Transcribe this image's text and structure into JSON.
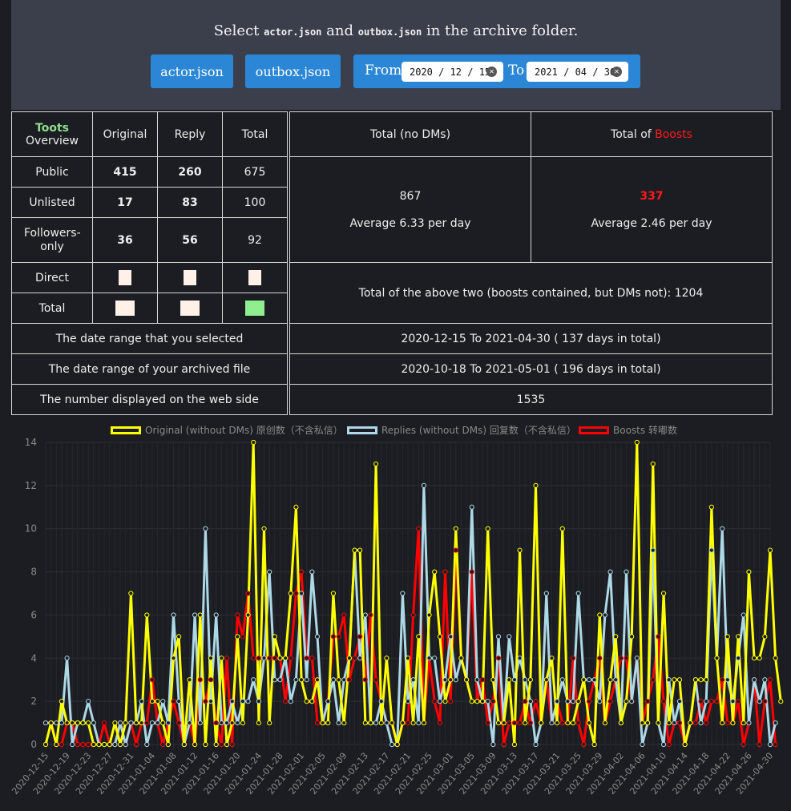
{
  "header": {
    "select_prefix": "Select",
    "file1": "actor.json",
    "and": "and",
    "file2": "outbox.json",
    "select_suffix": "in the archive folder.",
    "btn_actor": "actor.json",
    "btn_outbox": "outbox.json",
    "from_label": "From",
    "from_value": "2020 / 12 / 15",
    "to_label": "To",
    "to_value": "2021 / 04 / 30"
  },
  "table": {
    "toots": "Toots",
    "overview": "Overview",
    "col_original": "Original",
    "col_reply": "Reply",
    "col_total": "Total",
    "col_total_nodm": "Total (no DMs)",
    "col_total_of": "Total of",
    "col_boosts": "Boosts",
    "rows": [
      {
        "label": "Public",
        "original": "415",
        "reply": "260",
        "total": "675"
      },
      {
        "label": "Unlisted",
        "original": "17",
        "reply": "83",
        "total": "100"
      },
      {
        "label": "Followers-only",
        "original": "36",
        "reply": "56",
        "total": "92"
      },
      {
        "label": "Direct"
      },
      {
        "label": "Total"
      }
    ],
    "total_nodm_value": "867",
    "total_nodm_avg": "Average 6.33 per day",
    "boosts_value": "337",
    "boosts_avg": "Average 2.46 per day",
    "combined": "Total of the above two (boosts contained, but DMs not): 1204",
    "range_selected_label": "The date range that you selected",
    "range_selected_value": "2020-12-15 To 2021-04-30 ( 137 days in total)",
    "range_archive_label": "The date range of your archived file",
    "range_archive_value": "2020-10-18 To 2021-05-01 ( 196 days in total)",
    "web_label": "The number displayed on the web side",
    "web_value": "1535"
  },
  "colors": {
    "original": "#ffff00",
    "replies": "#add8e6",
    "boosts": "#ff0000",
    "square_light": "#fff0e8",
    "square_green": "#90ee90"
  },
  "chart_data": {
    "type": "line",
    "ylim": [
      0,
      14
    ],
    "yticks": [
      0,
      2,
      4,
      6,
      8,
      10,
      12,
      14
    ],
    "grid": true,
    "legend": "top",
    "x": [
      "2020-12-15",
      "2020-12-16",
      "2020-12-17",
      "2020-12-18",
      "2020-12-19",
      "2020-12-20",
      "2020-12-21",
      "2020-12-22",
      "2020-12-23",
      "2020-12-24",
      "2020-12-25",
      "2020-12-26",
      "2020-12-27",
      "2020-12-28",
      "2020-12-29",
      "2020-12-30",
      "2020-12-31",
      "2021-01-01",
      "2021-01-02",
      "2021-01-03",
      "2021-01-04",
      "2021-01-05",
      "2021-01-06",
      "2021-01-07",
      "2021-01-08",
      "2021-01-09",
      "2021-01-10",
      "2021-01-11",
      "2021-01-12",
      "2021-01-13",
      "2021-01-14",
      "2021-01-15",
      "2021-01-16",
      "2021-01-17",
      "2021-01-18",
      "2021-01-19",
      "2021-01-20",
      "2021-01-21",
      "2021-01-22",
      "2021-01-23",
      "2021-01-24",
      "2021-01-25",
      "2021-01-26",
      "2021-01-27",
      "2021-01-28",
      "2021-01-29",
      "2021-01-30",
      "2021-01-31",
      "2021-02-01",
      "2021-02-02",
      "2021-02-03",
      "2021-02-04",
      "2021-02-05",
      "2021-02-06",
      "2021-02-07",
      "2021-02-08",
      "2021-02-09",
      "2021-02-10",
      "2021-02-11",
      "2021-02-12",
      "2021-02-13",
      "2021-02-14",
      "2021-02-15",
      "2021-02-16",
      "2021-02-17",
      "2021-02-18",
      "2021-02-19",
      "2021-02-20",
      "2021-02-21",
      "2021-02-22",
      "2021-02-23",
      "2021-02-24",
      "2021-02-25",
      "2021-02-26",
      "2021-02-27",
      "2021-02-28",
      "2021-03-01",
      "2021-03-02",
      "2021-03-03",
      "2021-03-04",
      "2021-03-05",
      "2021-03-06",
      "2021-03-07",
      "2021-03-08",
      "2021-03-09",
      "2021-03-10",
      "2021-03-11",
      "2021-03-12",
      "2021-03-13",
      "2021-03-14",
      "2021-03-15",
      "2021-03-16",
      "2021-03-17",
      "2021-03-18",
      "2021-03-19",
      "2021-03-20",
      "2021-03-21",
      "2021-03-22",
      "2021-03-23",
      "2021-03-24",
      "2021-03-25",
      "2021-03-26",
      "2021-03-27",
      "2021-03-28",
      "2021-03-29",
      "2021-03-30",
      "2021-03-31",
      "2021-04-01",
      "2021-04-02",
      "2021-04-03",
      "2021-04-04",
      "2021-04-05",
      "2021-04-06",
      "2021-04-07",
      "2021-04-08",
      "2021-04-09",
      "2021-04-10",
      "2021-04-11",
      "2021-04-12",
      "2021-04-13",
      "2021-04-14",
      "2021-04-15",
      "2021-04-16",
      "2021-04-17",
      "2021-04-18",
      "2021-04-19",
      "2021-04-20",
      "2021-04-21",
      "2021-04-22",
      "2021-04-23",
      "2021-04-24",
      "2021-04-25",
      "2021-04-26",
      "2021-04-27",
      "2021-04-28",
      "2021-04-29",
      "2021-04-30"
    ],
    "xtick_labels": [
      "2020-12-15",
      "2020-12-19",
      "2020-12-23",
      "2020-12-27",
      "2020-12-31",
      "2021-01-04",
      "2021-01-08",
      "2021-01-12",
      "2021-01-16",
      "2021-01-20",
      "2021-01-24",
      "2021-01-28",
      "2021-02-01",
      "2021-02-05",
      "2021-02-09",
      "2021-02-13",
      "2021-02-17",
      "2021-02-21",
      "2021-02-25",
      "2021-03-01",
      "2021-03-05",
      "2021-03-09",
      "2021-03-13",
      "2021-03-17",
      "2021-03-21",
      "2021-03-25",
      "2021-03-29",
      "2021-04-02",
      "2021-04-06",
      "2021-04-10",
      "2021-04-14",
      "2021-04-18",
      "2021-04-22",
      "2021-04-26",
      "2021-04-30"
    ],
    "series": [
      {
        "name": "Original (without DMs) 原创数（不含私信）",
        "color": "#ffff00",
        "values": [
          0,
          1,
          0,
          2,
          1,
          1,
          1,
          1,
          1,
          0,
          0,
          0,
          0,
          1,
          0,
          1,
          7,
          1,
          1,
          6,
          2,
          2,
          1,
          0,
          4,
          5,
          0,
          3,
          0,
          6,
          0,
          4,
          0,
          4,
          0,
          1,
          5,
          1,
          6,
          14,
          1,
          10,
          1,
          5,
          4,
          4,
          7,
          11,
          3,
          2,
          2,
          3,
          1,
          1,
          7,
          3,
          1,
          4,
          9,
          9,
          1,
          1,
          13,
          1,
          4,
          1,
          0,
          1,
          4,
          1,
          5,
          1,
          6,
          8,
          5,
          2,
          3,
          10,
          4,
          3,
          2,
          2,
          2,
          10,
          3,
          1,
          1,
          3,
          0,
          9,
          1,
          3,
          12,
          1,
          3,
          4,
          1,
          10,
          1,
          1,
          2,
          3,
          1,
          0,
          6,
          1,
          3,
          5,
          1,
          2,
          5,
          14,
          1,
          1,
          13,
          1,
          7,
          1,
          3,
          3,
          0,
          1,
          3,
          3,
          3,
          11,
          4,
          1,
          5,
          1,
          5,
          1,
          8,
          4,
          4,
          5,
          9,
          4,
          2
        ]
      },
      {
        "name": "Replies (without DMs) 回复数（不含私信）",
        "color": "#add8e6",
        "values": [
          1,
          1,
          1,
          1,
          4,
          0,
          1,
          1,
          2,
          1,
          0,
          0,
          0,
          0,
          1,
          0,
          1,
          1,
          2,
          0,
          1,
          1,
          2,
          1,
          6,
          2,
          0,
          1,
          6,
          1,
          10,
          2,
          6,
          1,
          1,
          2,
          1,
          2,
          2,
          3,
          2,
          4,
          8,
          3,
          3,
          4,
          2,
          3,
          7,
          3,
          8,
          5,
          1,
          2,
          3,
          1,
          3,
          4,
          9,
          4,
          6,
          1,
          1,
          2,
          1,
          0,
          0,
          7,
          2,
          3,
          1,
          12,
          4,
          4,
          2,
          3,
          5,
          3,
          4,
          3,
          11,
          3,
          2,
          2,
          0,
          5,
          1,
          5,
          3,
          4,
          3,
          2,
          0,
          1,
          7,
          1,
          2,
          3,
          2,
          2,
          7,
          3,
          3,
          3,
          2,
          6,
          8,
          3,
          1,
          8,
          2,
          4,
          0,
          1,
          9,
          1,
          0,
          3,
          1,
          2,
          0,
          1,
          3,
          1,
          2,
          9,
          4,
          10,
          3,
          2,
          4,
          6,
          1,
          3,
          2,
          3,
          0,
          1
        ]
      },
      {
        "name": "Boosts 转嘟数",
        "color": "#ff0000",
        "values": [
          1,
          1,
          0,
          0,
          1,
          1,
          0,
          0,
          0,
          0,
          0,
          1,
          0,
          0,
          1,
          0,
          1,
          0,
          1,
          1,
          3,
          1,
          0,
          1,
          2,
          1,
          0,
          1,
          0,
          3,
          2,
          3,
          1,
          0,
          4,
          0,
          6,
          5,
          7,
          4,
          4,
          4,
          4,
          4,
          4,
          2,
          4,
          7,
          8,
          4,
          4,
          1,
          1,
          2,
          5,
          5,
          6,
          3,
          4,
          5,
          3,
          6,
          3,
          2,
          1,
          1,
          0,
          1,
          1,
          6,
          10,
          1,
          4,
          2,
          1,
          8,
          2,
          9,
          4,
          3,
          8,
          2,
          3,
          1,
          2,
          4,
          0,
          1,
          1,
          1,
          2,
          1,
          2,
          1,
          3,
          1,
          2,
          1,
          1,
          4,
          1,
          0,
          2,
          3,
          4,
          1,
          2,
          3,
          4,
          4,
          2,
          4,
          1,
          2,
          3,
          5,
          2,
          0,
          1,
          1,
          0,
          1,
          1,
          2,
          1,
          2,
          2,
          3,
          1,
          1,
          2,
          0,
          1,
          3,
          0,
          2,
          3,
          0
        ]
      }
    ]
  }
}
